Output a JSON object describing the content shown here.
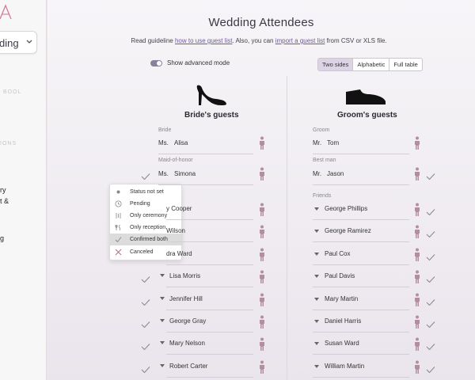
{
  "sidebar": {
    "select_label": "ding",
    "faint1": "BOOL",
    "faint2": "IONS",
    "items": [
      "ry",
      "t &",
      "g"
    ]
  },
  "main": {
    "title": "Wedding Attendees",
    "guide_prefix": "Read guideline ",
    "guide_link1": "how to use guest list",
    "guide_mid": ". Also, you can ",
    "guide_link2": "import a guest list",
    "guide_suffix": " from CSV or XLS file.",
    "toggle_label": "Show advanced mode",
    "view_options": [
      "Two sides",
      "Alphabetic",
      "Full table"
    ],
    "active_view": "Two sides"
  },
  "bride": {
    "heading": "Bride's guests",
    "roles": {
      "bride": "Bride",
      "maid": "Maid-of-honor"
    },
    "bride_guest": {
      "abbr": "Ms.",
      "name": "Alisa"
    },
    "maid_guest": {
      "abbr": "Ms.",
      "name": "Simona"
    },
    "friends": [
      "y Cooper",
      "Wilson",
      "dra Ward",
      "Lisa Morris",
      "Jennifer Hill",
      "George Gray",
      "Mary Nelson",
      "Robert Carter"
    ]
  },
  "groom": {
    "heading": "Groom's guests",
    "roles": {
      "groom": "Groom",
      "best": "Best man",
      "friends": "Friends"
    },
    "groom_guest": {
      "abbr": "Mr.",
      "name": "Tom"
    },
    "best_guest": {
      "abbr": "Mr.",
      "name": "Jason"
    },
    "friends": [
      "George Phillips",
      "George Ramirez",
      "Paul Cox",
      "Paul Davis",
      "Mary Martin",
      "Daniel Harris",
      "Susan Ward",
      "William Martin"
    ]
  },
  "status_menu": {
    "items": [
      "Status not set",
      "Pending",
      "Only ceremony",
      "Only reception",
      "Confirmed both",
      "Canceled"
    ],
    "selected": "Confirmed both"
  },
  "colors": {
    "accent": "#6f5a9a",
    "person_female": "#b38e9e",
    "check": "#8a8a90",
    "cancel": "#c06080"
  }
}
